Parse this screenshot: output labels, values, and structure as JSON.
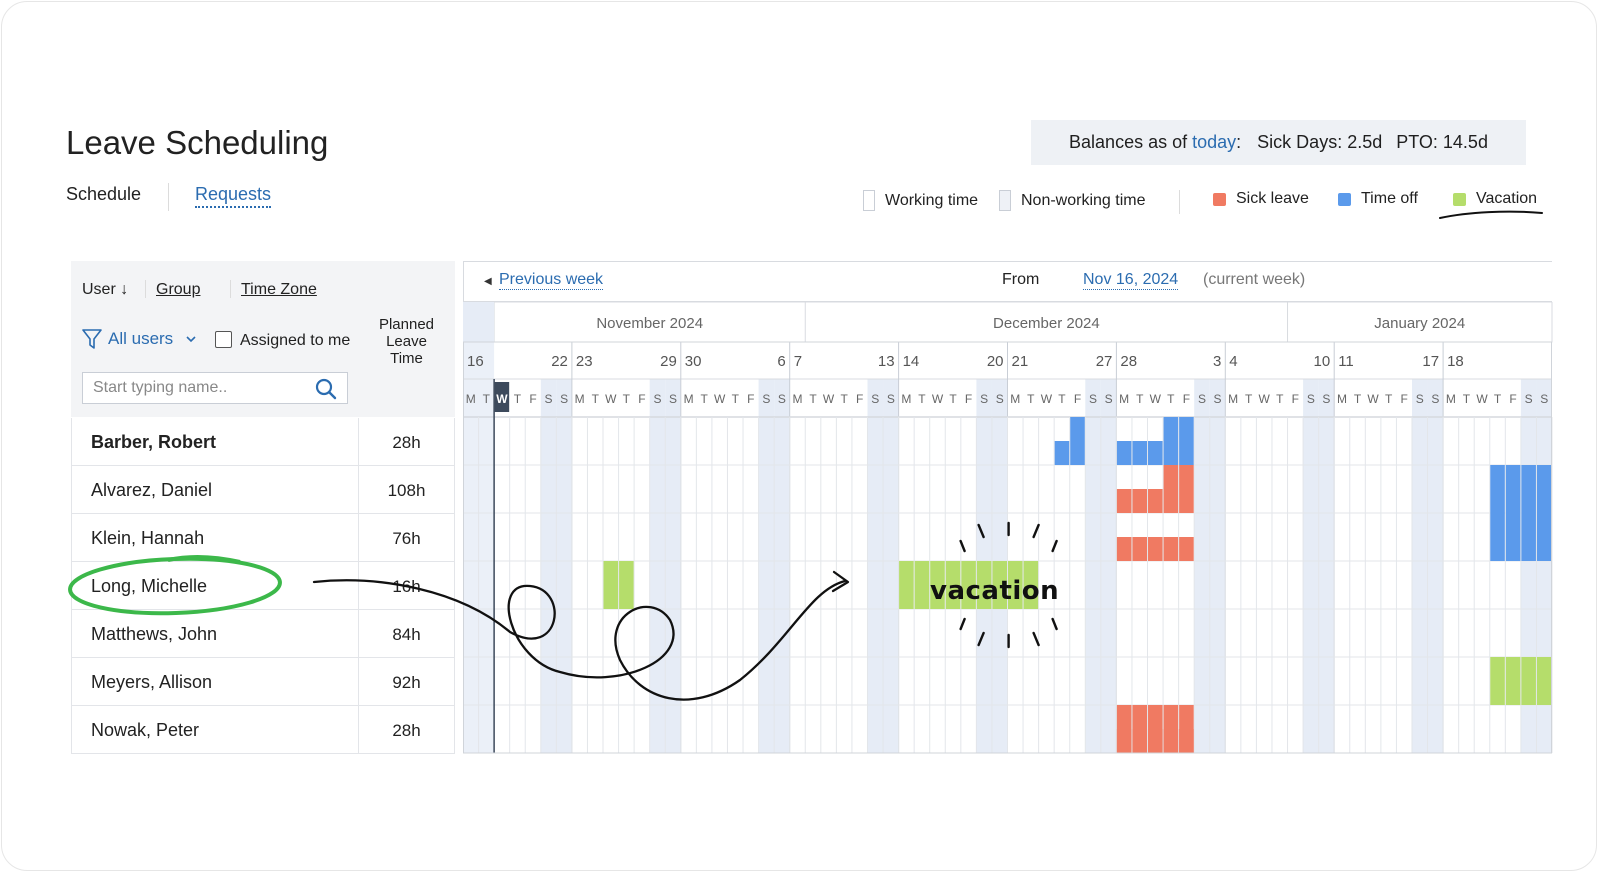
{
  "page": {
    "title": "Leave Scheduling",
    "tabs": [
      {
        "label": "Schedule"
      },
      {
        "label": "Requests"
      }
    ]
  },
  "balances": {
    "prefix": "Balances as of ",
    "link": "today",
    "colon": ":",
    "sick": "Sick Days: 2.5d",
    "pto": "PTO: 14.5d"
  },
  "legend": {
    "working": "Working time",
    "nonworking": "Non-working time",
    "sick": "Sick leave",
    "timeoff": "Time off",
    "vacation": "Vacation"
  },
  "colors": {
    "sick": "#f07a62",
    "timeoff": "#5b9aeb",
    "vacation": "#b5dd6b",
    "weekend": "#e6ecf6",
    "accent": "#2b6cb0"
  },
  "filters": {
    "user": "User",
    "group": "Group",
    "timezone": "Time Zone",
    "all_users": "All users",
    "assigned": "Assigned to me",
    "search_placeholder": "Start typing name..",
    "planned_header": "Planned Leave Time"
  },
  "nav": {
    "prev": "Previous week",
    "from": "From",
    "date": "Nov 16, 2024",
    "current": "(current week)"
  },
  "months": [
    "November 2024",
    "December 2024",
    "January 2024"
  ],
  "day_numbers": [
    "16",
    "22",
    "23",
    "29",
    "30",
    "6",
    "7",
    "13",
    "14",
    "20",
    "21",
    "27",
    "28",
    "3",
    "4",
    "10",
    "11",
    "17",
    "18"
  ],
  "dow_first": [
    "M",
    "T",
    "W",
    "T",
    "F",
    "S",
    "S"
  ],
  "users": [
    {
      "name": "Barber, Robert",
      "hours": "28h"
    },
    {
      "name": "Alvarez, Daniel",
      "hours": "108h"
    },
    {
      "name": "Klein, Hannah",
      "hours": "76h"
    },
    {
      "name": "Long, Michelle",
      "hours": "16h"
    },
    {
      "name": "Matthews, John",
      "hours": "84h"
    },
    {
      "name": "Meyers, Allison",
      "hours": "92h"
    },
    {
      "name": "Nowak, Peter",
      "hours": "28h"
    }
  ],
  "annotation": {
    "vacation": "vacation"
  }
}
